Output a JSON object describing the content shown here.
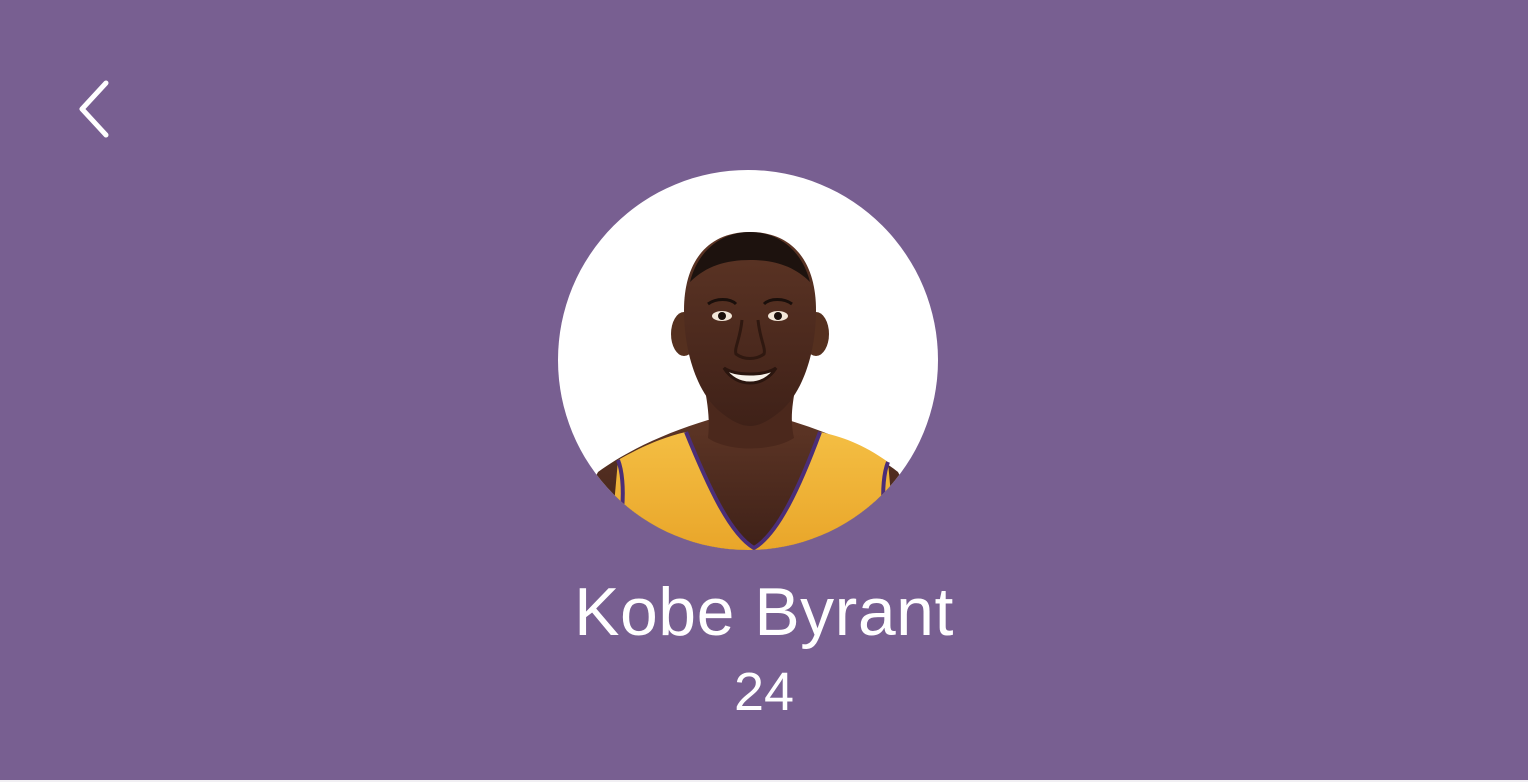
{
  "theme": {
    "background": "#785f91",
    "text": "#ffffff",
    "avatar_background": "#ffffff",
    "jersey_color": "#f0b43c",
    "jersey_trim": "#4b2e78"
  },
  "header": {
    "back_icon": "chevron-left-icon"
  },
  "profile": {
    "avatar_icon": "player-portrait",
    "name": "Kobe Byrant",
    "number": "24"
  }
}
